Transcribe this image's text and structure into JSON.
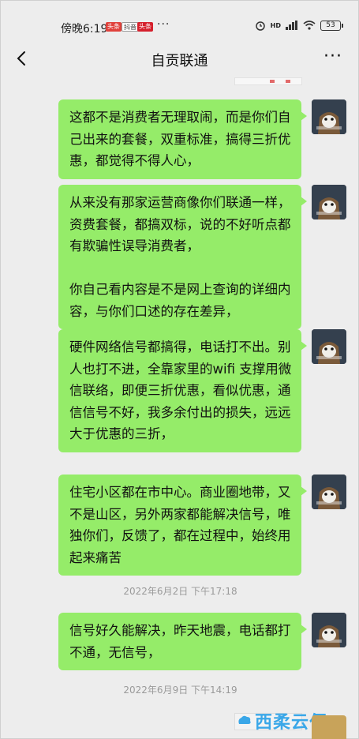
{
  "status_bar": {
    "time": "傍晚6:19",
    "badges": [
      "头条",
      "抖音",
      "头条"
    ],
    "more": "···",
    "network": "HD",
    "battery": "53"
  },
  "nav": {
    "title": "自贡联通",
    "more": "···"
  },
  "messages": [
    {
      "text": "这都不是消费者无理取闹，而是你们自己出来的套餐，双重标准，搞得三折优惠，都觉得不得人心，"
    },
    {
      "text": "从来没有那家运营商像你们联通一样，资费套餐，都搞双标，说的不好听点都有欺骗性误导消费者，\n\n你自己看内容是不是网上查询的详细内容，与你们口述的存在差异，"
    },
    {
      "text": "硬件网络信号都搞得，电话打不出。别人也打不进，全靠家里的wifi 支撑用微信联络，即便三折优惠，看似优惠，通信信号不好，我多余付出的损失，远远大于优惠的三折，"
    },
    {
      "text": "住宅小区都在市中心。商业圈地带，又不是山区，另外两家都能解决信号，唯独你们，反馈了，都在过程中，始终用起来痛苦"
    },
    {
      "text": "信号好久能解决，昨天地震，电话都打不通，无信号，"
    }
  ],
  "timestamps": [
    "2022年6月2日   下午17:18",
    "2022年6月9日   下午14:19"
  ],
  "watermark": "西柔云佰",
  "colors": {
    "background": "#ededed",
    "bubble": "#95ec69",
    "timestamp": "#9a9a9a",
    "watermark": "#3aa7e8"
  },
  "icons": {
    "back": "chevron-left-icon",
    "more": "more-dots-icon",
    "avatar": "cat-cartoon-avatar"
  }
}
